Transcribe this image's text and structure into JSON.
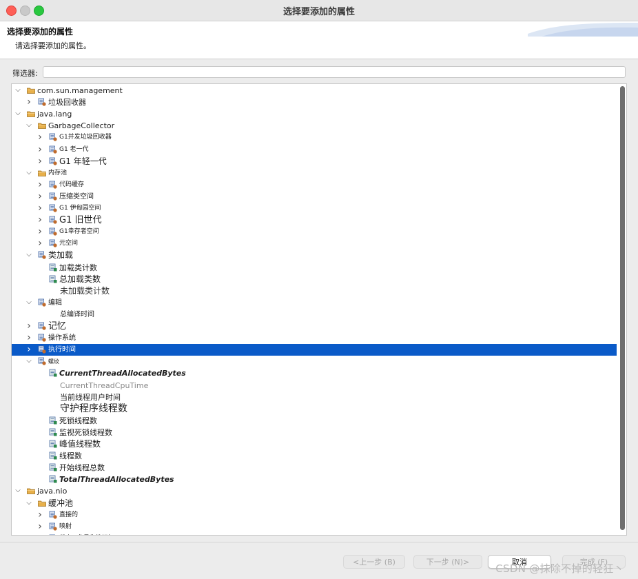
{
  "window": {
    "title": "选择要添加的属性"
  },
  "header": {
    "title": "选择要添加的属性",
    "description": "请选择要添加的属性。"
  },
  "filter": {
    "label": "筛选器:",
    "value": "",
    "placeholder": ""
  },
  "colors": {
    "selection": "#0a5ac8",
    "folder": "#e8b04a",
    "attribute_icon": "#2d8a4e"
  },
  "tree": [
    {
      "label": "com.sun.management",
      "level": 0,
      "expander": "expanded",
      "icon": "folder-icon"
    },
    {
      "label": "垃圾回收器",
      "level": 1,
      "expander": "collapsed",
      "icon": "mbean-icon"
    },
    {
      "label": "java.lang",
      "level": 0,
      "expander": "expanded",
      "icon": "folder-icon"
    },
    {
      "label": "GarbageCollector",
      "level": 1,
      "expander": "expanded",
      "icon": "folder-icon"
    },
    {
      "label": "G1并发垃圾回收器",
      "level": 2,
      "expander": "collapsed",
      "icon": "mbean-icon",
      "size": 9
    },
    {
      "label": "G1 老一代",
      "level": 2,
      "expander": "collapsed",
      "icon": "mbean-icon",
      "size": 9
    },
    {
      "label": "G1 年轻一代",
      "level": 2,
      "expander": "collapsed",
      "icon": "mbean-icon",
      "size": 12
    },
    {
      "label": "内存池",
      "level": 1,
      "expander": "expanded",
      "icon": "folder-icon",
      "size": 9
    },
    {
      "label": "代码缓存",
      "level": 2,
      "expander": "collapsed",
      "icon": "mbean-icon",
      "size": 9
    },
    {
      "label": "压缩类空间",
      "level": 2,
      "expander": "collapsed",
      "icon": "mbean-icon",
      "size": 10
    },
    {
      "label": "G1 伊甸园空间",
      "level": 2,
      "expander": "collapsed",
      "icon": "mbean-icon",
      "size": 9
    },
    {
      "label": "G1 旧世代",
      "level": 2,
      "expander": "collapsed",
      "icon": "mbean-icon",
      "size": 13
    },
    {
      "label": "G1幸存者空间",
      "level": 2,
      "expander": "collapsed",
      "icon": "mbean-icon",
      "size": 9
    },
    {
      "label": "元空间",
      "level": 2,
      "expander": "collapsed",
      "icon": "mbean-icon",
      "size": 9
    },
    {
      "label": "类加载",
      "level": 1,
      "expander": "expanded",
      "icon": "mbean-icon",
      "size": 12
    },
    {
      "label": "加载类计数",
      "level": 2,
      "expander": "none",
      "icon": "attribute-icon",
      "size": 11
    },
    {
      "label": "总加载类数",
      "level": 2,
      "expander": "none",
      "icon": "attribute-icon",
      "size": 12
    },
    {
      "label": "未加载类计数",
      "level": 2,
      "expander": "none",
      "icon": "none",
      "size": 12,
      "color": "#333"
    },
    {
      "label": "编辑",
      "level": 1,
      "expander": "expanded",
      "icon": "mbean-icon",
      "size": 10
    },
    {
      "label": "总编译时间",
      "level": 2,
      "expander": "none",
      "icon": "none",
      "size": 10
    },
    {
      "label": "记忆",
      "level": 1,
      "expander": "collapsed",
      "icon": "mbean-icon",
      "size": 13
    },
    {
      "label": "操作系统",
      "level": 1,
      "expander": "collapsed",
      "icon": "mbean-icon",
      "size": 10
    },
    {
      "label": "执行时间",
      "level": 1,
      "expander": "collapsed",
      "icon": "mbean-icon",
      "size": 10,
      "selected": true
    },
    {
      "label": "螺纹",
      "level": 1,
      "expander": "expanded",
      "icon": "mbean-icon",
      "size": 8
    },
    {
      "label": "CurrentThreadAllocatedBytes",
      "level": 2,
      "expander": "none",
      "icon": "attribute-icon",
      "size": 11,
      "italic": true,
      "bold": true
    },
    {
      "label": "CurrentThreadCpuTime",
      "level": 2,
      "expander": "none",
      "icon": "none",
      "size": 11,
      "color": "#888"
    },
    {
      "label": "当前线程用户时间",
      "level": 2,
      "expander": "none",
      "icon": "none",
      "size": 11
    },
    {
      "label": "守护程序线程数",
      "level": 2,
      "expander": "none",
      "icon": "none",
      "size": 14
    },
    {
      "label": "死锁线程数",
      "level": 2,
      "expander": "none",
      "icon": "attribute-icon",
      "size": 11
    },
    {
      "label": "监视死锁线程数",
      "level": 2,
      "expander": "none",
      "icon": "attribute-icon",
      "size": 11
    },
    {
      "label": "峰值线程数",
      "level": 2,
      "expander": "none",
      "icon": "attribute-icon",
      "size": 12
    },
    {
      "label": "线程数",
      "level": 2,
      "expander": "none",
      "icon": "attribute-icon",
      "size": 11
    },
    {
      "label": "开始线程总数",
      "level": 2,
      "expander": "none",
      "icon": "attribute-icon",
      "size": 11
    },
    {
      "label": "TotalThreadAllocatedBytes",
      "level": 2,
      "expander": "none",
      "icon": "attribute-icon",
      "size": 11,
      "italic": true,
      "bold": true
    },
    {
      "label": "java.nio",
      "level": 0,
      "expander": "expanded",
      "icon": "folder-icon"
    },
    {
      "label": "缓冲池",
      "level": 1,
      "expander": "expanded",
      "icon": "folder-icon",
      "size": 12
    },
    {
      "label": "直接的",
      "level": 2,
      "expander": "collapsed",
      "icon": "mbean-icon",
      "size": 9
    },
    {
      "label": "映射",
      "level": 2,
      "expander": "collapsed",
      "icon": "mbean-icon",
      "size": 9
    },
    {
      "label": "载人-“非易失性记忆”",
      "level": 2,
      "expander": "collapsed",
      "icon": "mbean-icon",
      "size": 9
    }
  ],
  "buttons": {
    "back": "<上一步 (B)",
    "next": "下一步 (N)>",
    "cancel": "取消",
    "finish": "完成 (F)"
  },
  "watermark": "CSDN @抹除不掉的轻狂丶"
}
